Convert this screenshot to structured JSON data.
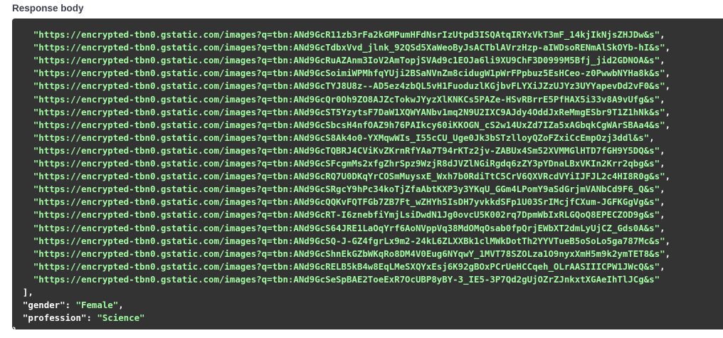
{
  "section_title": "Response body",
  "response": {
    "images": [
      "\"https://encrypted-tbn0.gstatic.com/images?q=tbn:ANd9GcR11zb3rFa2kGMPumHFdNsrIzUtpd3ISQAtqIRYxVkT3mF_14kjIkNjsZHJDw&s\"",
      "\"https://encrypted-tbn0.gstatic.com/images?q=tbn:ANd9GcTdbxVvd_jlnk_92QSd5XaWeoByJsACTblAVrzHzp-aIWDsoRENmAlSkOYb-hI&s\"",
      "\"https://encrypted-tbn0.gstatic.com/images?q=tbn:ANd9GcRuAZAnm3IoV2AmTopjSVAd9c1EOJa6li9XU9ChF3D0999M5Bfj_jid2GDNOA&s\"",
      "\"https://encrypted-tbn0.gstatic.com/images?q=tbn:ANd9GcSoimiWPMhfqYUji2BSaNVnZm8cidugW1pWrFPpbuz5EsHCeo-z0PwwbNYHa8k&s\"",
      "\"https://encrypted-tbn0.gstatic.com/images?q=tbn:ANd9GcTYJ8U8z--AD5ez4zbQL5vH1FuoduzlKGjbvFLYXiJZzUJYz3UYYapevDd2vF0&s\"",
      "\"https://encrypted-tbn0.gstatic.com/images?q=tbn:ANd9GcQr0Oh9ZO8AJZcTokwJYyzXlKNKCs5PAZe-HSvRBrrE5PfHAX5i33v8A9vUfg&s\"",
      "\"https://encrypted-tbn0.gstatic.com/images?q=tbn:ANd9GcST5YzytsF7DaW1XQWYANbv1mq2N9U2IXC9AJdy4OddJxReMmgESbr9T1Z1hNk&s\"",
      "\"https://encrypted-tbn0.gstatic.com/images?q=tbn:ANd9GcSbcsH4nfOAZ9h76PAIkcy60iKKOGN_cS2w14UxZd7IZa5xAGbqkCgWArSBAa4&s\"",
      "\"https://encrypted-tbn0.gstatic.com/images?q=tbn:ANd9GcS8Ak4o0-YXMqwWIs_I55cCU_Uge0Jk3bSTzlloyQZoFZxiCcEmpOzj3ddl&s\"",
      "\"https://encrypted-tbn0.gstatic.com/images?q=tbn:ANd9GcTQBRJ4CViKvZKrnRfYAa7T94rKTz2jv-ZABUx4Sm52XVMMGlHTD7fGH9Y5DQ&s\"",
      "\"https://encrypted-tbn0.gstatic.com/images?q=tbn:ANd9GcSFcgmMs2xfgZhrSpz9WzjR8dJVZlNGiRgdq6zZY3pYDnaLBxVKIn2Krr2qbg&s\"",
      "\"https://encrypted-tbn0.gstatic.com/images?q=tbn:ANd9GcRQ7U0DKqYrCOSmMuysxE_Wxh7b0RdiTtC5CrV6QXVRcdVYiIJFJL2c4HI8R0g&s\"",
      "\"https://encrypted-tbn0.gstatic.com/images?q=tbn:ANd9GcSRgcY9hPc34koTjZfaAbtKXP3y3YKqU_GGm4LPomY9aSdGrjmVANbCd9F6_Q&s\"",
      "\"https://encrypted-tbn0.gstatic.com/images?q=tbn:ANd9GcQQKvFQTFGb7ZB7Ft_wZHYh5IsDH7yvkkdSFp1U03SrIMcjfCXum-JGFKGgVg&s\"",
      "\"https://encrypted-tbn0.gstatic.com/images?q=tbn:ANd9GcRT-I6znebfiYmjLsiDwdN1Jg0ovcU5K002rq7DpmWbIxRLGQoQ8EPECZOD9g&s\"",
      "\"https://encrypted-tbn0.gstatic.com/images?q=tbn:ANd9GcS64JRE1LaOqYrf6AoNVppVq38MdOMqOsab0fpQrjEWbXT2dmLyUjCZ_Gds0A&s\"",
      "\"https://encrypted-tbn0.gstatic.com/images?q=tbn:ANd9GcSQ-J-GZ4fgrLx9m2-24kL6ZLXXBk1clMWkDotTh2YYVTueB5oSoLo5ga787Mc&s\"",
      "\"https://encrypted-tbn0.gstatic.com/images?q=tbn:ANd9GcShnEkGZbWKqRo8DM4V0Eug6NYqwY_1MVT78SZOLza1O9nyxXmH5m9k2ymTET8&s\"",
      "\"https://encrypted-tbn0.gstatic.com/images?q=tbn:ANd9GcRELB5kB4w8EqLMeSXQYxEsj6K92gBOxPCrUeHCCqeh_OLrAASIIICPW1JWcQ&s\"",
      "\"https://encrypted-tbn0.gstatic.com/images?q=tbn:ANd9GcSeSpBAE2ToeExR7OcUBP8yBY-3_IE5-3P7Qd2gUjOZrZJnkxtXGAeIhTlJCg&s\""
    ],
    "array_close": "],",
    "gender_key": "\"gender\"",
    "gender_value": "\"Female\"",
    "profession_key": "\"profession\"",
    "profession_value": "\"Science\"",
    "object_close": "}"
  }
}
